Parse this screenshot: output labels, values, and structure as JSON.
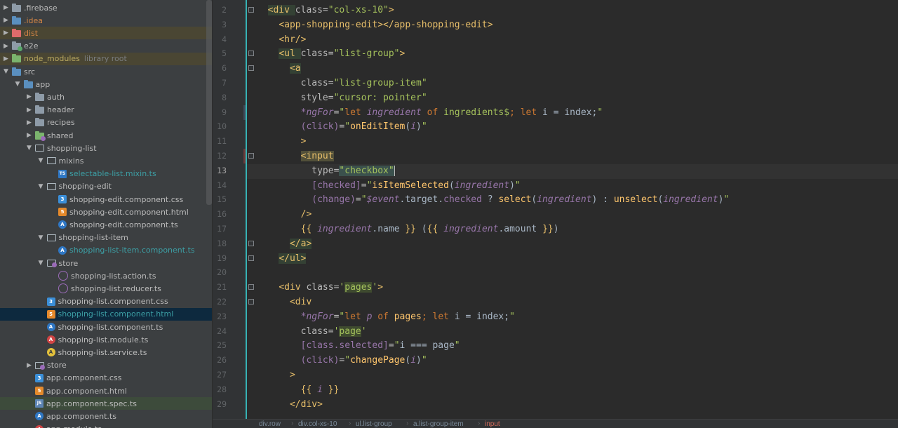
{
  "tree": {
    "items": [
      {
        "label": ".firebase",
        "level": 0,
        "arrow": "closed",
        "icon": "folder-icon",
        "color": ""
      },
      {
        "label": ".idea",
        "level": 0,
        "arrow": "closed",
        "icon": "folder-idea-icon",
        "color": "orange"
      },
      {
        "label": "dist",
        "level": 0,
        "arrow": "closed",
        "icon": "folder-excluded-icon",
        "color": "orange",
        "hl": "yellow"
      },
      {
        "label": "e2e",
        "level": 0,
        "arrow": "closed",
        "icon": "folder-test-icon",
        "color": ""
      },
      {
        "label": "node_modules",
        "sub": "library root",
        "level": 0,
        "arrow": "closed",
        "icon": "folder-library-icon",
        "color": "yellow",
        "hl": "yellow"
      },
      {
        "label": "src",
        "level": 0,
        "arrow": "open",
        "icon": "folder-source-icon",
        "color": ""
      },
      {
        "label": "app",
        "level": 1,
        "arrow": "open",
        "icon": "folder-source-icon",
        "color": ""
      },
      {
        "label": "auth",
        "level": 2,
        "arrow": "closed",
        "icon": "folder-icon",
        "color": ""
      },
      {
        "label": "header",
        "level": 2,
        "arrow": "closed",
        "icon": "folder-icon",
        "color": ""
      },
      {
        "label": "recipes",
        "level": 2,
        "arrow": "closed",
        "icon": "folder-icon",
        "color": ""
      },
      {
        "label": "shared",
        "level": 2,
        "arrow": "closed",
        "icon": "folder-module-icon",
        "color": ""
      },
      {
        "label": "shopping-list",
        "level": 2,
        "arrow": "open",
        "icon": "folder-open-icon",
        "color": ""
      },
      {
        "label": "mixins",
        "level": 3,
        "arrow": "open",
        "icon": "folder-open-icon",
        "color": ""
      },
      {
        "label": "selectable-list.mixin.ts",
        "level": 4,
        "arrow": "none",
        "icon": "typescript-file-icon",
        "color": "teal"
      },
      {
        "label": "shopping-edit",
        "level": 3,
        "arrow": "open",
        "icon": "folder-open-icon",
        "color": ""
      },
      {
        "label": "shopping-edit.component.css",
        "level": 4,
        "arrow": "none",
        "icon": "css-file-icon",
        "color": ""
      },
      {
        "label": "shopping-edit.component.html",
        "level": 4,
        "arrow": "none",
        "icon": "html-file-icon",
        "color": ""
      },
      {
        "label": "shopping-edit.component.ts",
        "level": 4,
        "arrow": "none",
        "icon": "angular-component-icon",
        "color": ""
      },
      {
        "label": "shopping-list-item",
        "level": 3,
        "arrow": "open",
        "icon": "folder-open-icon",
        "color": ""
      },
      {
        "label": "shopping-list-item.component.ts",
        "level": 4,
        "arrow": "none",
        "icon": "angular-component-icon",
        "color": "teal"
      },
      {
        "label": "store",
        "level": 3,
        "arrow": "open",
        "icon": "folder-store-icon",
        "color": ""
      },
      {
        "label": "shopping-list.action.ts",
        "level": 4,
        "arrow": "none",
        "icon": "ngrx-action-icon",
        "color": ""
      },
      {
        "label": "shopping-list.reducer.ts",
        "level": 4,
        "arrow": "none",
        "icon": "ngrx-reducer-icon",
        "color": ""
      },
      {
        "label": "shopping-list.component.css",
        "level": 3,
        "arrow": "none",
        "icon": "css-file-icon",
        "color": ""
      },
      {
        "label": "shopping-list.component.html",
        "level": 3,
        "arrow": "none",
        "icon": "html-file-icon",
        "color": "teal",
        "hl": "sel"
      },
      {
        "label": "shopping-list.component.ts",
        "level": 3,
        "arrow": "none",
        "icon": "angular-component-icon",
        "color": ""
      },
      {
        "label": "shopping-list.module.ts",
        "level": 3,
        "arrow": "none",
        "icon": "angular-module-icon",
        "color": ""
      },
      {
        "label": "shopping-list.service.ts",
        "level": 3,
        "arrow": "none",
        "icon": "angular-service-icon",
        "color": ""
      },
      {
        "label": "store",
        "level": 2,
        "arrow": "closed",
        "icon": "folder-store-icon",
        "color": ""
      },
      {
        "label": "app.component.css",
        "level": 2,
        "arrow": "none",
        "icon": "css-file-icon",
        "color": ""
      },
      {
        "label": "app.component.html",
        "level": 2,
        "arrow": "none",
        "icon": "html-file-icon",
        "color": ""
      },
      {
        "label": "app.component.spec.ts",
        "level": 2,
        "arrow": "none",
        "icon": "spec-file-icon",
        "color": "",
        "hl": "green"
      },
      {
        "label": "app.component.ts",
        "level": 2,
        "arrow": "none",
        "icon": "angular-component-icon",
        "color": ""
      },
      {
        "label": "app.module.ts",
        "level": 2,
        "arrow": "none",
        "icon": "angular-module-icon",
        "color": ""
      }
    ]
  },
  "editor": {
    "current_line": "13",
    "lines": [
      {
        "num": "2",
        "tokens": [
          [
            "",
            "  "
          ],
          [
            "tag",
            "<div "
          ],
          [
            "attr",
            "class="
          ],
          [
            "str",
            "\"col-xs-10\""
          ],
          [
            "tag",
            ">"
          ]
        ]
      },
      {
        "num": "3",
        "tokens": [
          [
            "",
            "    "
          ],
          [
            "tag",
            "<app-shopping-edit></app-shopping-edit>"
          ]
        ]
      },
      {
        "num": "4",
        "tokens": [
          [
            "",
            "    "
          ],
          [
            "tag",
            "<hr/>"
          ]
        ]
      },
      {
        "num": "5",
        "tokens": [
          [
            "",
            "    "
          ],
          [
            "tag",
            "<ul "
          ],
          [
            "attr",
            "class="
          ],
          [
            "str",
            "\"list-group\""
          ],
          [
            "tag",
            ">"
          ]
        ]
      },
      {
        "num": "6",
        "tokens": [
          [
            "",
            "      "
          ],
          [
            "tag",
            "<a"
          ]
        ]
      },
      {
        "num": "7",
        "tokens": [
          [
            "",
            "        "
          ],
          [
            "attr",
            "class="
          ],
          [
            "str",
            "\"list-group-item\""
          ]
        ]
      },
      {
        "num": "8",
        "tokens": [
          [
            "",
            "        "
          ],
          [
            "attr",
            "style="
          ],
          [
            "str",
            "\"cursor: pointer\""
          ]
        ]
      },
      {
        "num": "9",
        "tokens": [
          [
            "",
            "        "
          ],
          [
            "dir",
            "*ngFor"
          ],
          [
            "attr",
            "="
          ],
          [
            "str",
            "\""
          ],
          [
            "kw",
            "let "
          ],
          [
            "var",
            "ingredient"
          ],
          [
            "kw",
            " of "
          ],
          [
            "str",
            "ingredients$"
          ],
          [
            "kw",
            "; let "
          ],
          [
            "plain",
            "i = index;"
          ],
          [
            "str",
            "\""
          ]
        ]
      },
      {
        "num": "10",
        "tokens": [
          [
            "",
            "        "
          ],
          [
            "bind",
            "(click)"
          ],
          [
            "attr",
            "="
          ],
          [
            "str",
            "\""
          ],
          [
            "fn",
            "onEditItem"
          ],
          [
            "plain",
            "("
          ],
          [
            "var",
            "i"
          ],
          [
            "plain",
            ")"
          ],
          [
            "str",
            "\""
          ]
        ]
      },
      {
        "num": "11",
        "tokens": [
          [
            "",
            "        "
          ],
          [
            "tag",
            ">"
          ]
        ]
      },
      {
        "num": "12",
        "tokens": [
          [
            "",
            "        "
          ],
          [
            "tag",
            "<input"
          ]
        ]
      },
      {
        "num": "13",
        "tokens": [
          [
            "",
            "          "
          ],
          [
            "attr",
            "type="
          ],
          [
            "str",
            "\"checkbox\""
          ]
        ]
      },
      {
        "num": "14",
        "tokens": [
          [
            "",
            "          "
          ],
          [
            "bind",
            "[checked]"
          ],
          [
            "attr",
            "="
          ],
          [
            "str",
            "\""
          ],
          [
            "fn",
            "isItemSelected"
          ],
          [
            "plain",
            "("
          ],
          [
            "var",
            "ingredient"
          ],
          [
            "plain",
            ")"
          ],
          [
            "str",
            "\""
          ]
        ]
      },
      {
        "num": "15",
        "tokens": [
          [
            "",
            "          "
          ],
          [
            "bind",
            "(change)"
          ],
          [
            "attr",
            "="
          ],
          [
            "str",
            "\""
          ],
          [
            "var",
            "$event"
          ],
          [
            "plain",
            ".target."
          ],
          [
            "bind",
            "checked"
          ],
          [
            "plain",
            " ? "
          ],
          [
            "fn",
            "select"
          ],
          [
            "plain",
            "("
          ],
          [
            "var",
            "ingredient"
          ],
          [
            "plain",
            ") : "
          ],
          [
            "fn",
            "unselect"
          ],
          [
            "plain",
            "("
          ],
          [
            "var",
            "ingredient"
          ],
          [
            "plain",
            ")"
          ],
          [
            "str",
            "\""
          ]
        ]
      },
      {
        "num": "16",
        "tokens": [
          [
            "",
            "        "
          ],
          [
            "tag",
            "/>"
          ]
        ]
      },
      {
        "num": "17",
        "tokens": [
          [
            "",
            "        "
          ],
          [
            "tag",
            "{{ "
          ],
          [
            "var",
            "ingredient"
          ],
          [
            "plain",
            ".name "
          ],
          [
            "tag",
            "}}"
          ],
          [
            "plain",
            " ("
          ],
          [
            "tag",
            "{{ "
          ],
          [
            "var",
            "ingredient"
          ],
          [
            "plain",
            ".amount "
          ],
          [
            "tag",
            "}}"
          ],
          [
            "plain",
            ")"
          ]
        ]
      },
      {
        "num": "18",
        "tokens": [
          [
            "",
            "      "
          ],
          [
            "tag",
            "</a>"
          ]
        ]
      },
      {
        "num": "19",
        "tokens": [
          [
            "",
            "    "
          ],
          [
            "tag",
            "</ul>"
          ]
        ]
      },
      {
        "num": "20",
        "tokens": []
      },
      {
        "num": "21",
        "tokens": [
          [
            "",
            "    "
          ],
          [
            "tag",
            "<div "
          ],
          [
            "attr",
            "class="
          ],
          [
            "str",
            "'"
          ],
          [
            "pages",
            "pages"
          ],
          [
            "str",
            "'"
          ],
          [
            "tag",
            ">"
          ]
        ]
      },
      {
        "num": "22",
        "tokens": [
          [
            "",
            "      "
          ],
          [
            "tag",
            "<div"
          ]
        ]
      },
      {
        "num": "23",
        "tokens": [
          [
            "",
            "        "
          ],
          [
            "dir",
            "*ngFor"
          ],
          [
            "attr",
            "="
          ],
          [
            "str",
            "\""
          ],
          [
            "kw",
            "let "
          ],
          [
            "var",
            "p"
          ],
          [
            "kw",
            " of "
          ],
          [
            "fn",
            "pages"
          ],
          [
            "kw",
            "; let "
          ],
          [
            "plain",
            "i = index;"
          ],
          [
            "str",
            "\""
          ]
        ]
      },
      {
        "num": "24",
        "tokens": [
          [
            "",
            "        "
          ],
          [
            "attr",
            "class="
          ],
          [
            "str",
            "'"
          ],
          [
            "pages",
            "page"
          ],
          [
            "str",
            "'"
          ]
        ]
      },
      {
        "num": "25",
        "tokens": [
          [
            "",
            "        "
          ],
          [
            "bind",
            "[class.selected]"
          ],
          [
            "attr",
            "="
          ],
          [
            "str",
            "\""
          ],
          [
            "plain",
            "i === page"
          ],
          [
            "str",
            "\""
          ]
        ]
      },
      {
        "num": "26",
        "tokens": [
          [
            "",
            "        "
          ],
          [
            "bind",
            "(click)"
          ],
          [
            "attr",
            "="
          ],
          [
            "str",
            "\""
          ],
          [
            "fn",
            "changePage"
          ],
          [
            "plain",
            "("
          ],
          [
            "var",
            "i"
          ],
          [
            "plain",
            ")"
          ],
          [
            "str",
            "\""
          ]
        ]
      },
      {
        "num": "27",
        "tokens": [
          [
            "",
            "      "
          ],
          [
            "tag",
            ">"
          ]
        ]
      },
      {
        "num": "28",
        "tokens": [
          [
            "",
            "        "
          ],
          [
            "tag",
            "{{ "
          ],
          [
            "var",
            "i"
          ],
          [
            "tag",
            " }}"
          ]
        ]
      },
      {
        "num": "29",
        "tokens": [
          [
            "",
            "      "
          ],
          [
            "tag",
            "</div>"
          ]
        ]
      }
    ]
  },
  "breadcrumb": {
    "items": [
      "div.row",
      "div.col-xs-10",
      "ul.list-group",
      "a.list-group-item",
      "input"
    ]
  },
  "colors": {
    "accent_guide": "#36b3b5",
    "selection": "#0d293e",
    "excluded_highlight": "#4a4633"
  }
}
